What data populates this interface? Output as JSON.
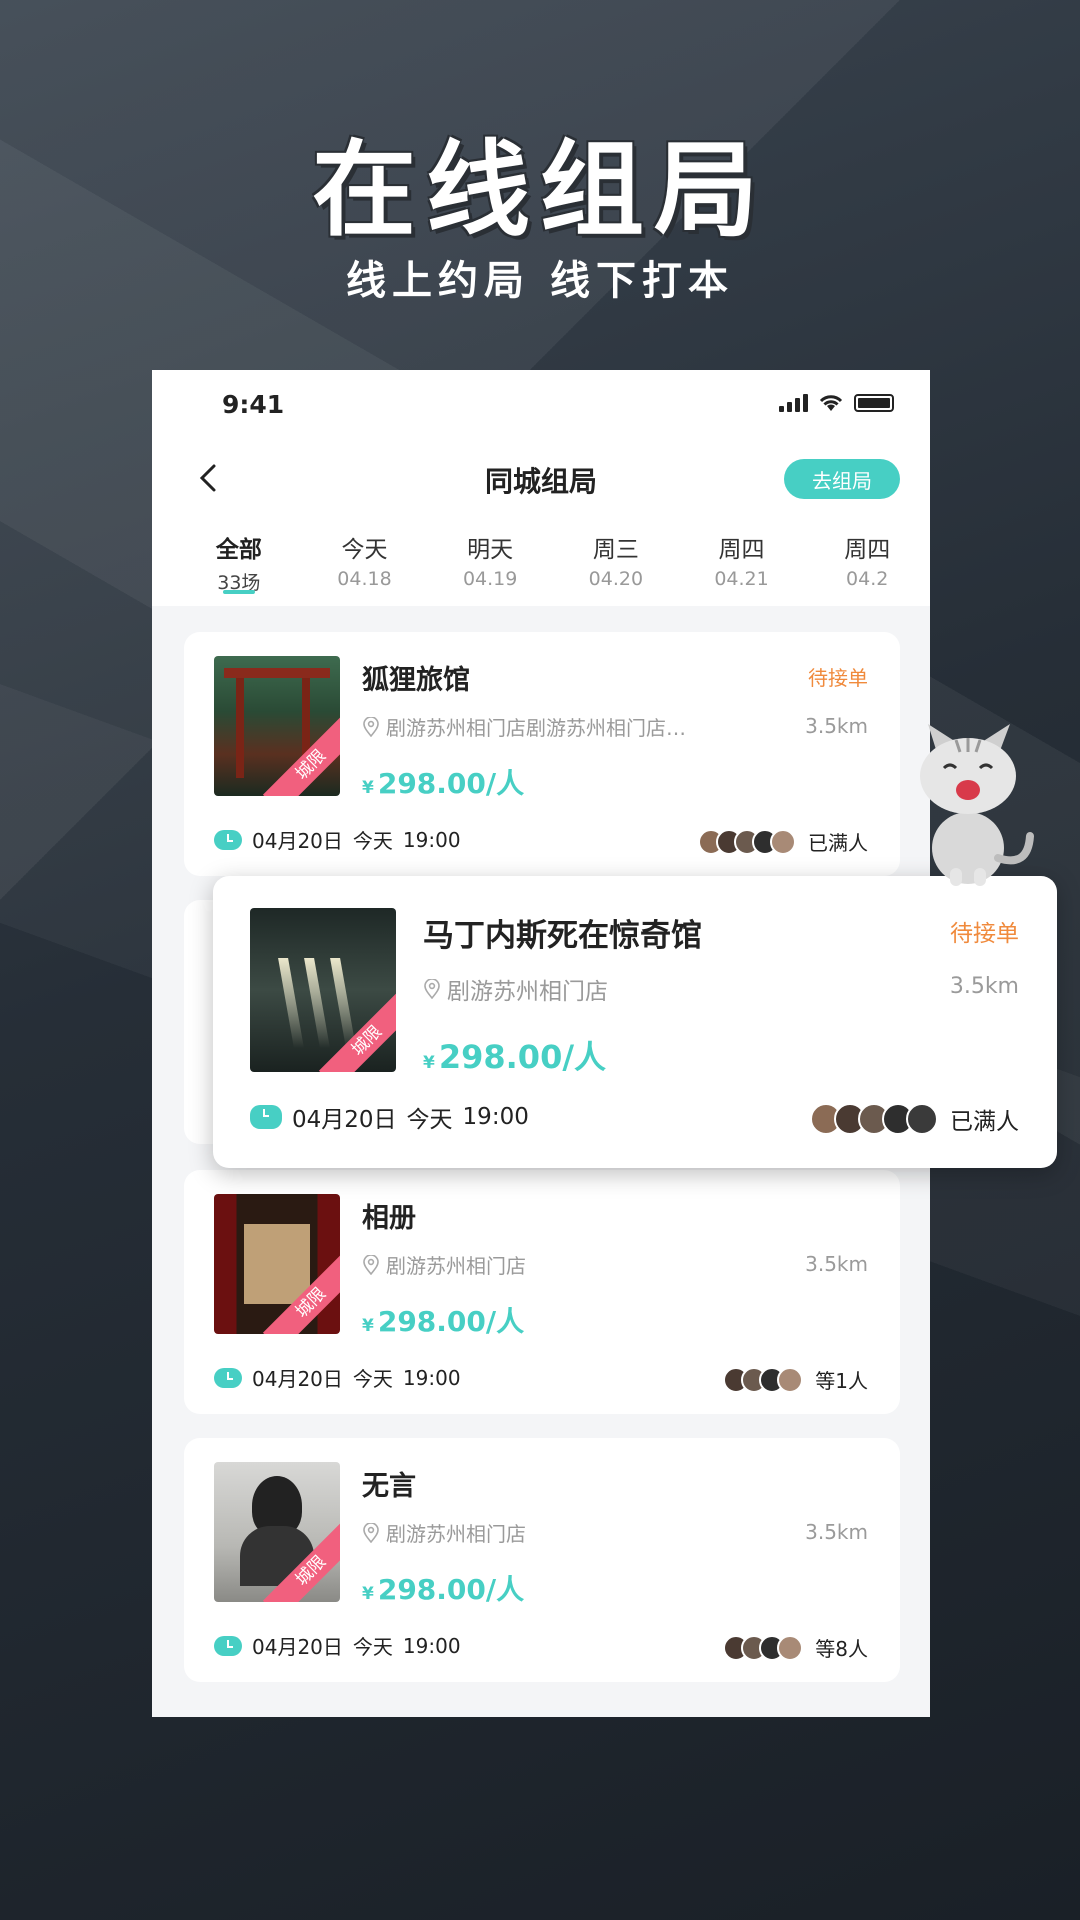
{
  "hero": {
    "title": "在线组局",
    "subtitle": "线上约局 线下打本"
  },
  "status_bar": {
    "time": "9:41"
  },
  "nav": {
    "title": "同城组局",
    "action": "去组局"
  },
  "tabs": [
    {
      "label": "全部",
      "sub": "33场",
      "active": true
    },
    {
      "label": "今天",
      "sub": "04.18"
    },
    {
      "label": "明天",
      "sub": "04.19"
    },
    {
      "label": "周三",
      "sub": "04.20"
    },
    {
      "label": "周四",
      "sub": "04.21"
    },
    {
      "label": "周四",
      "sub": "04.2"
    }
  ],
  "cards": [
    {
      "title": "狐狸旅馆",
      "status": "待接单",
      "location": "剧游苏州相门店剧游苏州相门店…",
      "distance": "3.5km",
      "price_symbol": "¥",
      "price": "298.00/人",
      "tag": "城限",
      "date": "04月20日",
      "day": "今天",
      "time": "19:00",
      "people": "已满人"
    },
    {
      "title": "马丁内斯死在惊奇馆",
      "status": "待接单",
      "location": "剧游苏州相门店",
      "distance": "3.5km",
      "price_symbol": "¥",
      "price": "298.00/人",
      "tag": "城限",
      "date": "04月20日",
      "day": "今天",
      "time": "19:00",
      "people": "已满人"
    },
    {
      "title": "相册",
      "status": "",
      "location": "剧游苏州相门店",
      "distance": "3.5km",
      "price_symbol": "¥",
      "price": "298.00/人",
      "tag": "城限",
      "date": "04月20日",
      "day": "今天",
      "time": "19:00",
      "people": "等1人"
    },
    {
      "title": "无言",
      "status": "",
      "location": "剧游苏州相门店",
      "distance": "3.5km",
      "price_symbol": "¥",
      "price": "298.00/人",
      "tag": "城限",
      "date": "04月20日",
      "day": "今天",
      "time": "19:00",
      "people": "等8人"
    }
  ],
  "colors": {
    "accent": "#47cfc4",
    "status": "#f08a3c",
    "tag": "#f1607e"
  }
}
